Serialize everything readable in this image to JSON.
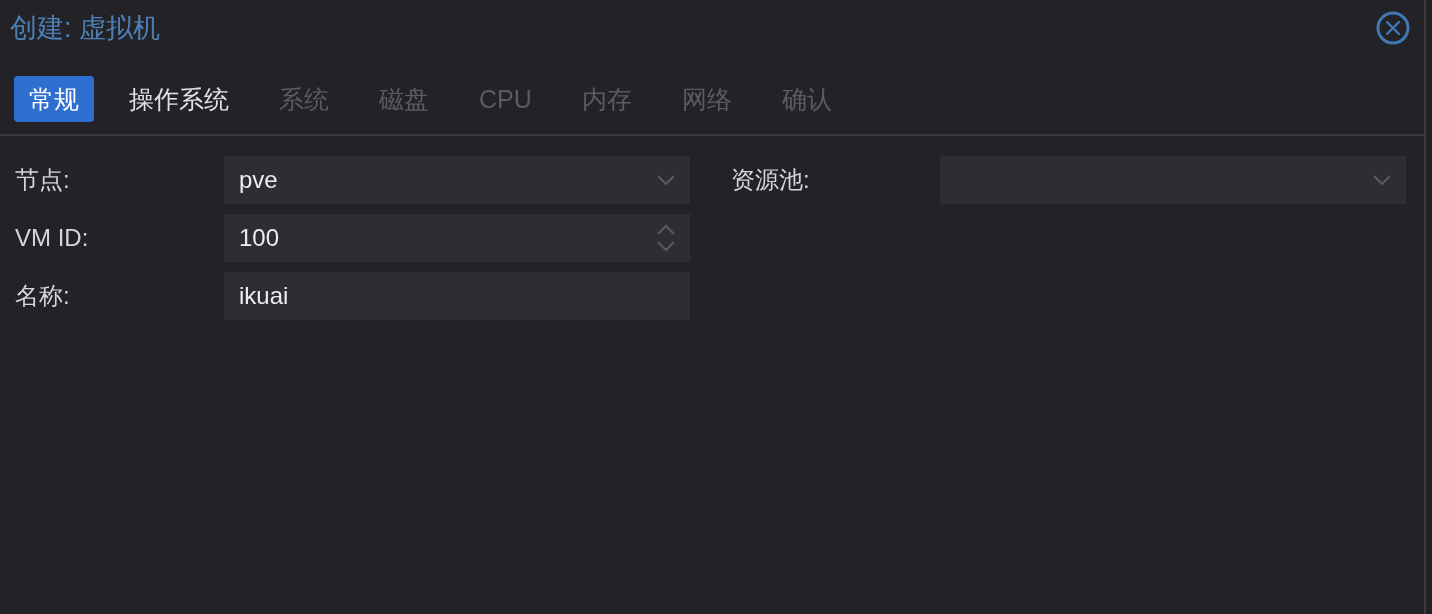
{
  "window": {
    "title": "创建: 虚拟机"
  },
  "tabs": [
    {
      "label": "常规",
      "selected": true,
      "disabled": false
    },
    {
      "label": "操作系统",
      "selected": false,
      "disabled": false
    },
    {
      "label": "系统",
      "selected": false,
      "disabled": true
    },
    {
      "label": "磁盘",
      "selected": false,
      "disabled": true
    },
    {
      "label": "CPU",
      "selected": false,
      "disabled": true
    },
    {
      "label": "内存",
      "selected": false,
      "disabled": true
    },
    {
      "label": "网络",
      "selected": false,
      "disabled": true
    },
    {
      "label": "确认",
      "selected": false,
      "disabled": true
    }
  ],
  "form": {
    "columns": [
      {
        "fields": [
          {
            "kind": "combo",
            "label": "节点:",
            "value": "pve"
          },
          {
            "kind": "spinner",
            "label": "VM ID:",
            "value": "100"
          },
          {
            "kind": "text",
            "label": "名称:",
            "value": "ikuai"
          }
        ]
      },
      {
        "fields": [
          {
            "kind": "combo",
            "label": "资源池:"
          }
        ]
      }
    ]
  }
}
